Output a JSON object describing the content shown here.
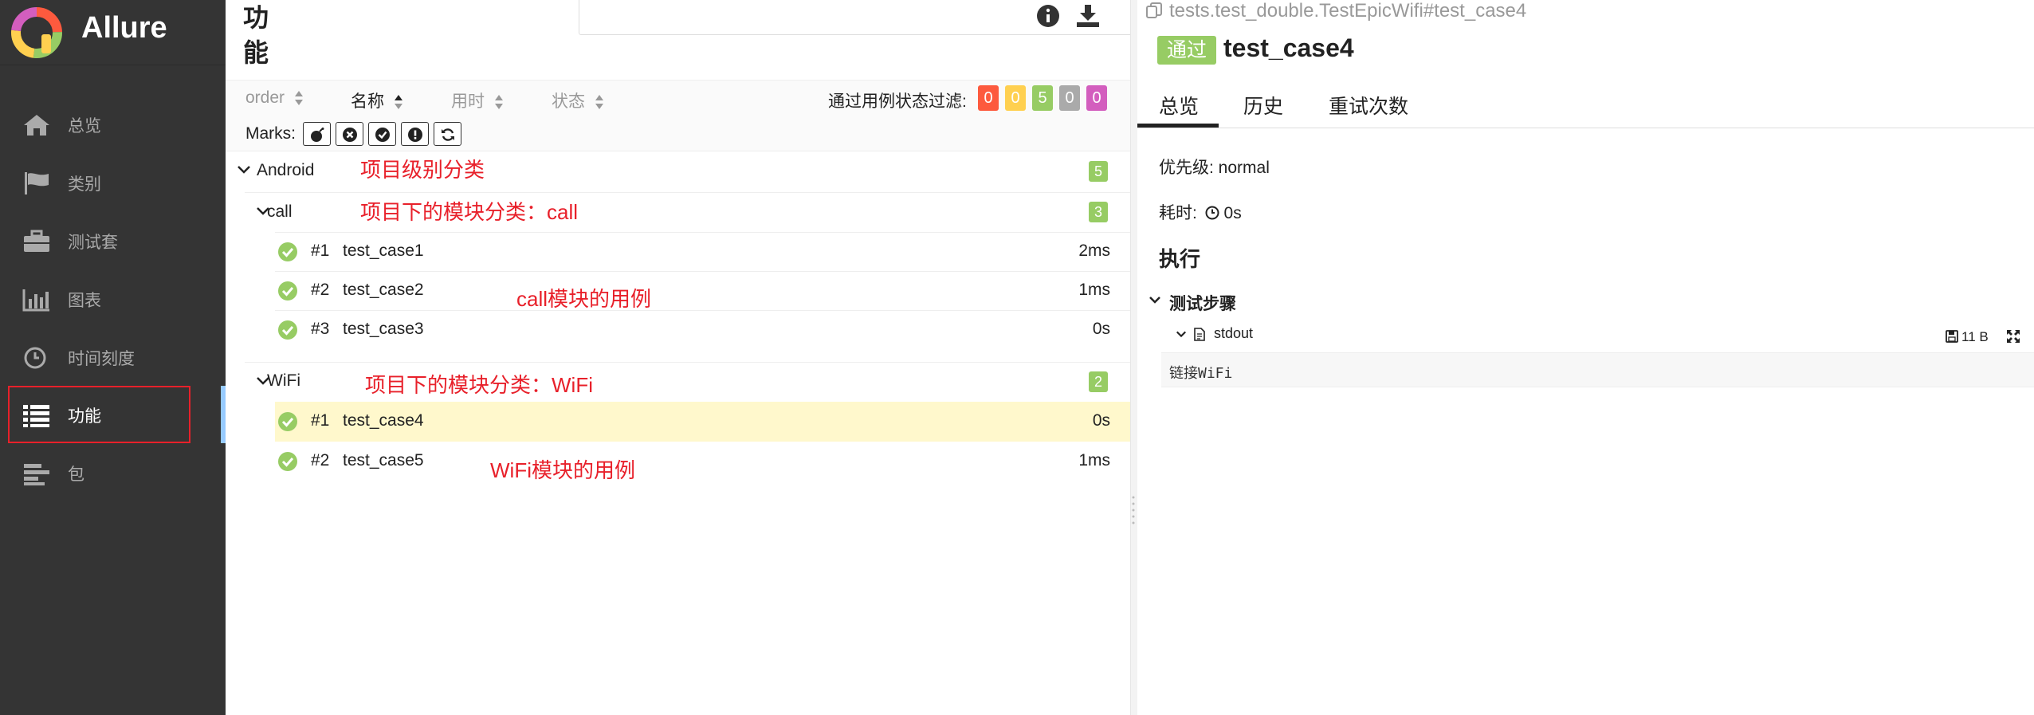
{
  "brand": {
    "name": "Allure"
  },
  "sidebar": {
    "items": [
      {
        "label": "总览",
        "icon": "home-icon"
      },
      {
        "label": "类别",
        "icon": "flag-icon"
      },
      {
        "label": "测试套",
        "icon": "briefcase-icon"
      },
      {
        "label": "图表",
        "icon": "bar-chart-icon"
      },
      {
        "label": "时间刻度",
        "icon": "clock-icon"
      },
      {
        "label": "功能",
        "icon": "list-icon",
        "active": true
      },
      {
        "label": "包",
        "icon": "align-left-icon"
      }
    ]
  },
  "main": {
    "title": "功能",
    "sort": {
      "columns": [
        {
          "label": "order"
        },
        {
          "label": "名称",
          "active": true
        },
        {
          "label": "用时"
        },
        {
          "label": "状态"
        }
      ]
    },
    "filter": {
      "label": "通过用例状态过滤:",
      "badges": [
        {
          "value": "0",
          "color": "#fd5a3e"
        },
        {
          "value": "0",
          "color": "#ffd050"
        },
        {
          "value": "5",
          "color": "#97cc64"
        },
        {
          "value": "0",
          "color": "#aaaaaa"
        },
        {
          "value": "0",
          "color": "#d35ebe"
        }
      ]
    },
    "marks": {
      "label": "Marks:"
    },
    "tree": {
      "project": {
        "name": "Android",
        "count": "5",
        "annotation": "项目级别分类"
      },
      "modules": [
        {
          "name": "call",
          "count": "3",
          "annotation": "项目下的模块分类：call",
          "cases_annotation": "call模块的用例",
          "cases": [
            {
              "order": "#1",
              "name": "test_case1",
              "duration": "2ms"
            },
            {
              "order": "#2",
              "name": "test_case2",
              "duration": "1ms"
            },
            {
              "order": "#3",
              "name": "test_case3",
              "duration": "0s"
            }
          ]
        },
        {
          "name": "WiFi",
          "count": "2",
          "annotation": "项目下的模块分类：WiFi",
          "cases_annotation": "WiFi模块的用例",
          "cases": [
            {
              "order": "#1",
              "name": "test_case4",
              "duration": "0s"
            },
            {
              "order": "#2",
              "name": "test_case5",
              "duration": "1ms"
            }
          ]
        }
      ]
    }
  },
  "detail": {
    "path": "tests.test_double.TestEpicWifi#test_case4",
    "status": "通过",
    "title": "test_case4",
    "tabs": [
      {
        "label": "总览",
        "active": true
      },
      {
        "label": "历史"
      },
      {
        "label": "重试次数"
      }
    ],
    "severity": "优先级: normal",
    "duration_label": "耗时:",
    "duration_value": "0s",
    "execution_title": "执行",
    "steps_title": "测试步骤",
    "attachment": {
      "name": "stdout",
      "size": "11 B",
      "content": "链接WiFi"
    }
  },
  "colors": {
    "accent": "#97cc64",
    "annotation": "#e8202a",
    "sidebar": "#343434"
  }
}
